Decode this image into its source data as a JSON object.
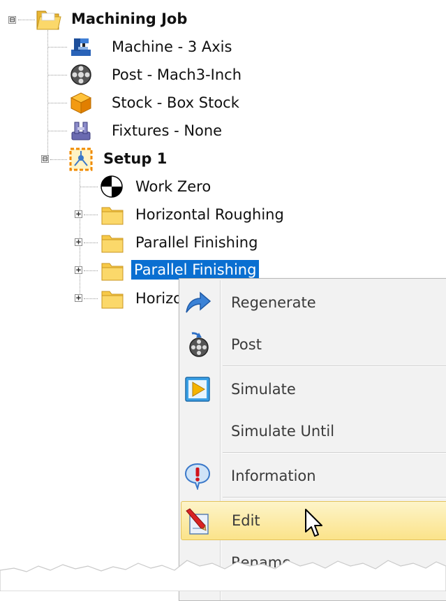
{
  "tree": {
    "root": {
      "label": "Machining Job",
      "expander": "⊟"
    },
    "items": [
      {
        "label": "Machine - 3 Axis",
        "icon": "machine-icon"
      },
      {
        "label": "Post - Mach3-Inch",
        "icon": "post-reel-icon"
      },
      {
        "label": "Stock - Box Stock",
        "icon": "stock-box-icon"
      },
      {
        "label": "Fixtures - None",
        "icon": "fixtures-icon"
      }
    ],
    "setup": {
      "label": "Setup 1",
      "expander": "⊟",
      "children": [
        {
          "label": "Work Zero",
          "icon": "work-zero-icon"
        },
        {
          "label": "Horizontal Roughing",
          "icon": "folder-icon",
          "expander": "+"
        },
        {
          "label": "Parallel Finishing",
          "icon": "folder-icon",
          "expander": "+"
        },
        {
          "label": "Parallel Finishing",
          "icon": "folder-icon",
          "expander": "+",
          "selected": true
        },
        {
          "label": "Horizo",
          "icon": "folder-icon",
          "expander": "+"
        }
      ]
    }
  },
  "context_menu": {
    "items": [
      {
        "label": "Regenerate",
        "icon": "regenerate-arrow-icon"
      },
      {
        "label": "Post",
        "icon": "post-reel-icon"
      },
      {
        "label": "Simulate",
        "icon": "simulate-play-icon"
      },
      {
        "label": "Simulate Until",
        "icon": ""
      },
      {
        "label": "Information",
        "icon": "information-icon"
      },
      {
        "label": "Edit",
        "icon": "edit-pencil-icon",
        "highlighted": true
      },
      {
        "label": "Rename",
        "icon": ""
      }
    ]
  },
  "colors": {
    "selection": "#0a6fd1",
    "menu_background": "#f2f2f2",
    "highlight_top": "#fdf4c9",
    "highlight_bottom": "#fbe38a",
    "folder": "#f7c948"
  }
}
